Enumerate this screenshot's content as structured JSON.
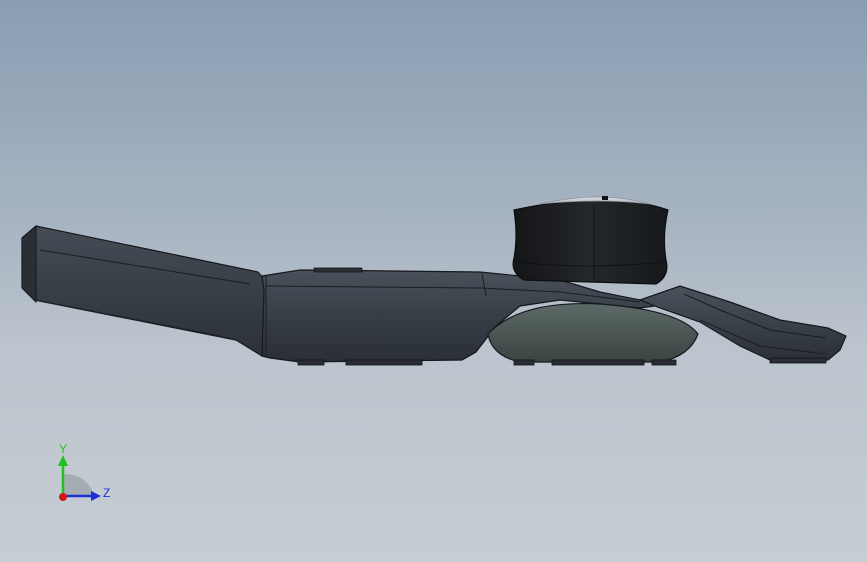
{
  "triad": {
    "y_axis_label": "Y",
    "z_axis_label": "Z",
    "y_color": "#1ec21e",
    "z_color": "#1f2fd6",
    "x_color": "#d01818"
  },
  "model": {
    "body_color": "#363c44",
    "knob_color": "#1c1e21",
    "knob_cap_color": "#c6c9d0",
    "base_dome_color": "#45504c",
    "edge_color": "#14161a"
  },
  "background": {
    "top_color": "#8a9db3",
    "bottom_color": "#c7cdd4"
  }
}
